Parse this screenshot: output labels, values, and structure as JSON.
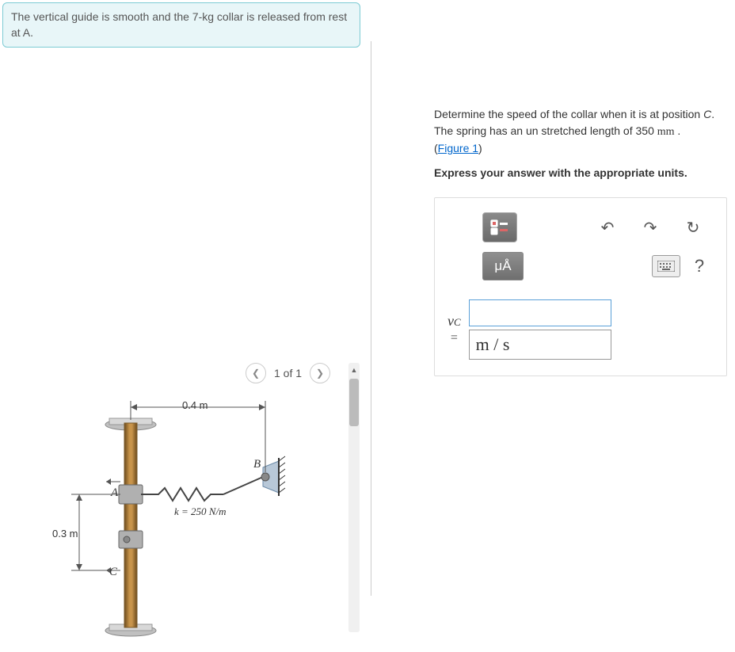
{
  "problem": {
    "intro": "The vertical guide is smooth and the 7-kg collar is released from rest at A."
  },
  "figure_nav": {
    "counter": "1 of 1"
  },
  "figure": {
    "dim_horizontal": "0.4 m",
    "dim_vertical": "0.3 m",
    "point_A": "A",
    "point_B": "B",
    "point_C": "C",
    "spring_k": "k = 250 N/m"
  },
  "question": {
    "p1a": "Determine the speed of the collar when it is at position ",
    "p1b": ". The spring has an un stretched length of 350 ",
    "pointC": "C",
    "unit_mm": "mm",
    "period": " .",
    "figlink": "Figure 1",
    "p2": "Express your answer with the appropriate units."
  },
  "toolbar": {
    "templates_title": "Templates",
    "mu_label": "μÅ",
    "help": "?"
  },
  "answer": {
    "var": "vC",
    "eq": "=",
    "value": "",
    "units": "m / s"
  }
}
